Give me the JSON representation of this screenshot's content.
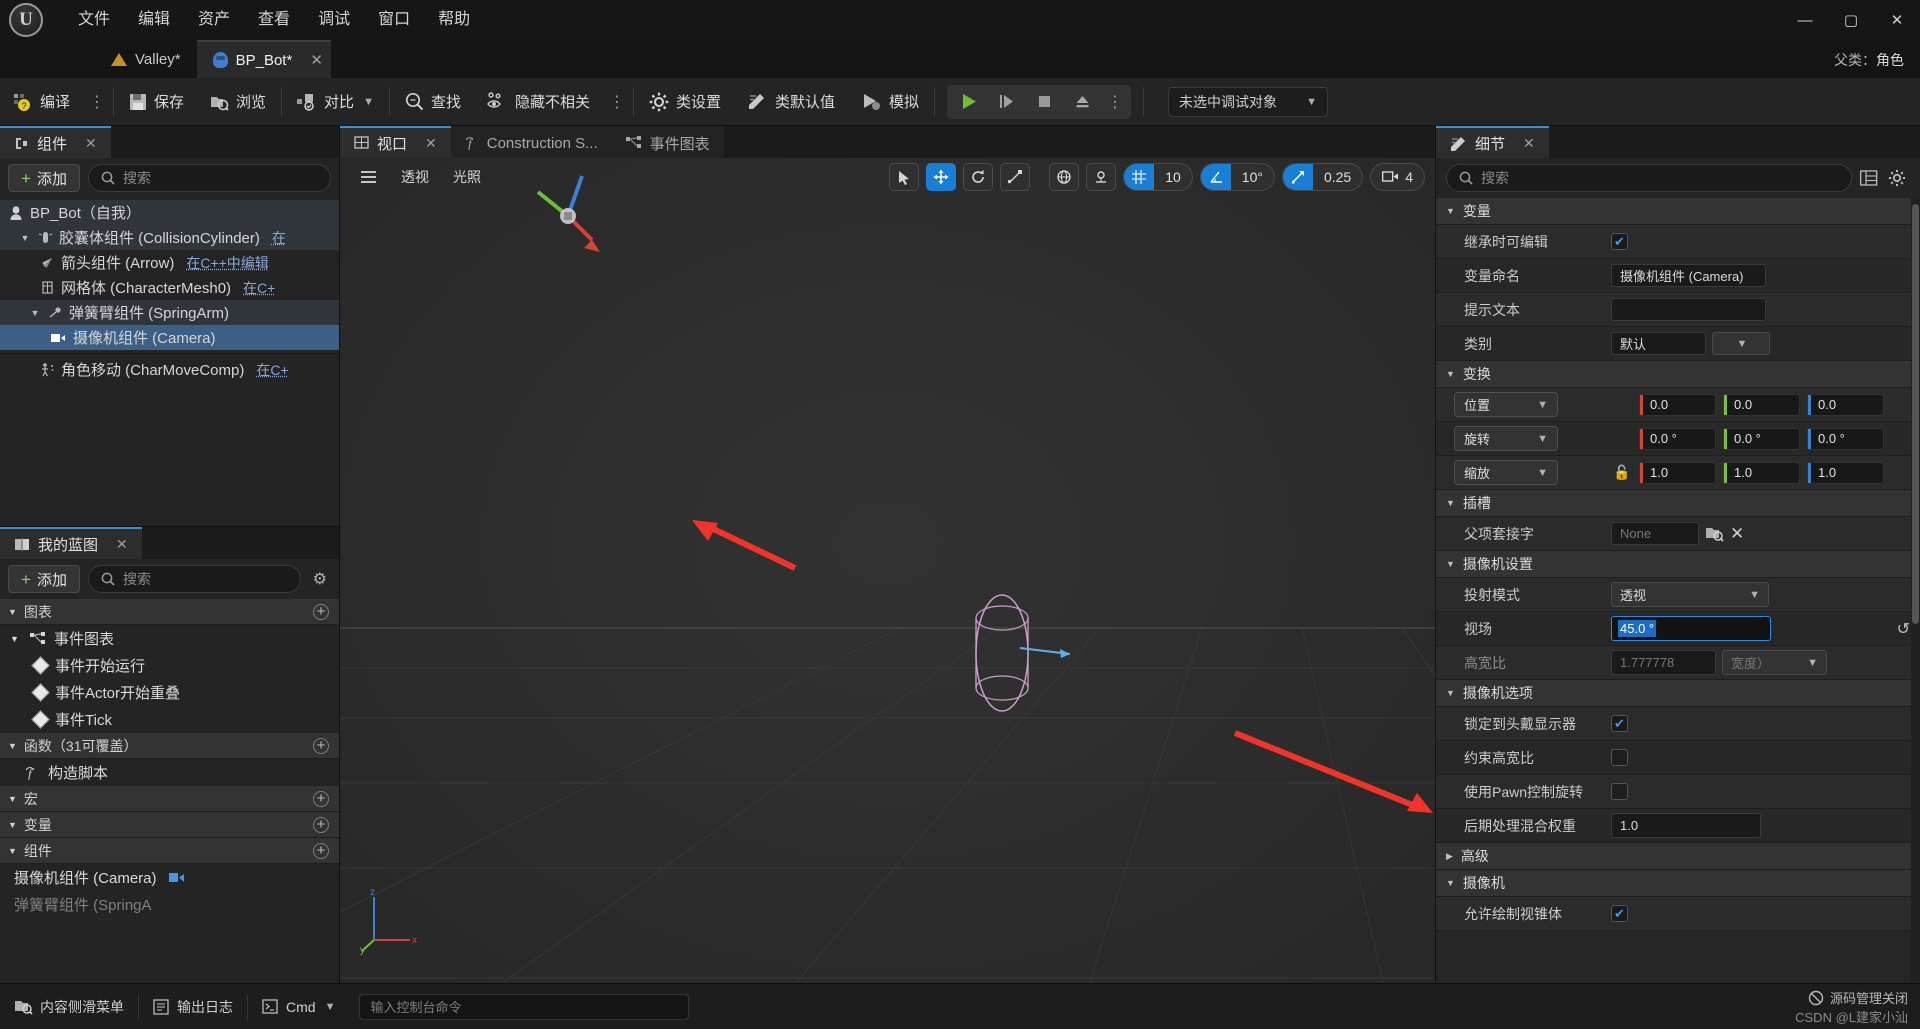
{
  "window": {
    "menu": [
      "文件",
      "编辑",
      "资产",
      "查看",
      "调试",
      "窗口",
      "帮助"
    ],
    "minimize": "—",
    "maximize": "▢",
    "close": "✕"
  },
  "tabs": {
    "project": "Valley*",
    "asset": "BP_Bot*",
    "close": "✕",
    "parent_class_label": "父类：",
    "parent_class_value": "角色"
  },
  "toolbar": {
    "compile": "编译",
    "save": "保存",
    "browse": "浏览",
    "diff": "对比",
    "find": "查找",
    "hide_unrelated": "隐藏不相关",
    "class_settings": "类设置",
    "class_defaults": "类默认值",
    "simulate": "模拟",
    "debug_object": "未选中调试对象",
    "kebab": "⋮"
  },
  "components_panel": {
    "tab_title": "组件",
    "close": "✕",
    "add": "添加",
    "search_placeholder": "搜索",
    "tree": [
      {
        "label": "BP_Bot（自我）",
        "indent": 0,
        "icon": "bot-icon",
        "arrow": "",
        "cpp": "",
        "state": "hl"
      },
      {
        "label": "胶囊体组件 (CollisionCylinder)",
        "indent": 1,
        "icon": "capsule-icon",
        "arrow": "▼",
        "cpp": "在",
        "state": "hl"
      },
      {
        "label": "箭头组件 (Arrow)",
        "indent": 2,
        "icon": "arrow-icon",
        "arrow": "",
        "cpp": "在C++中编辑",
        "state": ""
      },
      {
        "label": "网格体 (CharacterMesh0)",
        "indent": 2,
        "icon": "mesh-icon",
        "arrow": "",
        "cpp": "在C+",
        "state": ""
      },
      {
        "label": "弹簧臂组件 (SpringArm)",
        "indent": 2,
        "icon": "spring-icon",
        "arrow": "▼",
        "cpp": "",
        "state": "hl"
      },
      {
        "label": "摄像机组件 (Camera)",
        "indent": 3,
        "icon": "camera-icon",
        "arrow": "",
        "cpp": "",
        "state": "sel"
      },
      {
        "label": "角色移动 (CharMoveComp)",
        "indent": 2,
        "icon": "move-icon",
        "arrow": "",
        "cpp": "在C+",
        "state": ""
      }
    ]
  },
  "myblueprint_panel": {
    "tab_title": "我的蓝图",
    "close": "✕",
    "add": "添加",
    "search_placeholder": "搜索",
    "gear": "⚙",
    "sections": [
      {
        "title": "图表",
        "plus": "+"
      },
      {
        "title": "函数（31可覆盖）",
        "plus": "+"
      },
      {
        "title": "宏",
        "plus": "+"
      },
      {
        "title": "变量",
        "plus": "+"
      },
      {
        "title": "组件",
        "plus": "+"
      }
    ],
    "graph_root": "事件图表",
    "graph_events": [
      "事件开始运行",
      "事件Actor开始重叠",
      "事件Tick"
    ],
    "function_items": [
      "构造脚本"
    ],
    "component_items": [
      "摄像机组件 (Camera)",
      "弹簧臂组件 (SpringA"
    ]
  },
  "center_tabs": {
    "viewport": "视口",
    "viewport_close": "✕",
    "construction": "Construction S...",
    "eventgraph": "事件图表"
  },
  "viewport": {
    "menu_icon": "hamburger-icon",
    "perspective": "透视",
    "lighting": "光照",
    "grid_snap_value": "10",
    "angle_snap_value": "10°",
    "scale_snap_value": "0.25",
    "camera_speed_value": "4"
  },
  "details_panel": {
    "tab_title": "细节",
    "close": "✕",
    "search_placeholder": "搜索",
    "categories": {
      "variable": "变量",
      "transform": "变换",
      "socket": "插槽",
      "camera_settings": "摄像机设置",
      "camera_options": "摄像机选项",
      "advanced": "高级",
      "camera": "摄像机"
    },
    "rows": {
      "editable_on_instance": {
        "label": "继承时可编辑",
        "checked": true
      },
      "variable_name": {
        "label": "变量命名",
        "value": "摄像机组件 (Camera)"
      },
      "tooltip": {
        "label": "提示文本",
        "value": ""
      },
      "category": {
        "label": "类别",
        "value": "默认"
      },
      "location": {
        "label": "位置",
        "x": "0.0",
        "y": "0.0",
        "z": "0.0"
      },
      "rotation": {
        "label": "旋转",
        "x": "0.0 °",
        "y": "0.0 °",
        "z": "0.0 °"
      },
      "scale": {
        "label": "缩放",
        "x": "1.0",
        "y": "1.0",
        "z": "1.0",
        "lock": "🔓"
      },
      "parent_socket": {
        "label": "父项套接字",
        "value": "None"
      },
      "projection_mode": {
        "label": "投射模式",
        "value": "透视"
      },
      "field_of_view": {
        "label": "视场",
        "value": "45.0 °",
        "reset": "↺"
      },
      "aspect_ratio": {
        "label": "高宽比",
        "value": "1.777778",
        "unit": "宽度）"
      },
      "lock_to_hmd": {
        "label": "锁定到头戴显示器",
        "checked": true
      },
      "constrain_aspect": {
        "label": "约束高宽比",
        "checked": false
      },
      "use_pawn_control_rotation": {
        "label": "使用Pawn控制旋转",
        "checked": false
      },
      "post_process_blend": {
        "label": "后期处理混合权重",
        "value": "1.0"
      },
      "draw_frustum": {
        "label": "允许绘制视锥体",
        "checked": true
      }
    }
  },
  "statusbar": {
    "content_drawer": "内容侧滑菜单",
    "output_log": "输出日志",
    "cmd": "Cmd",
    "cmd_placeholder": "输入控制台命令",
    "right_label": "源码管理关闭",
    "watermark": "CSDN @L建家小汕"
  },
  "colors": {
    "accent_blue": "#1a7fd4",
    "selection_blue": "#3c5f86",
    "green": "#8ed16a",
    "axis_x": "#d4443a",
    "axis_y": "#77c03c",
    "axis_z": "#3d7fd4",
    "annotation_red": "#f0342a"
  }
}
